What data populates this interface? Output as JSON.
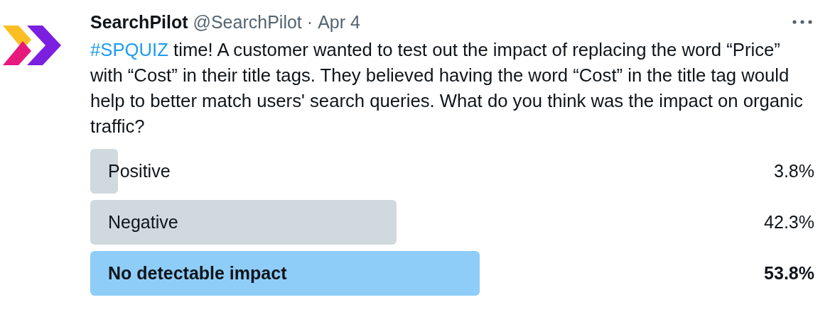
{
  "author": {
    "name": "SearchPilot",
    "handle": "@SearchPilot",
    "separator": "·",
    "date": "Apr 4"
  },
  "tweet": {
    "hashtag": "#SPQUIZ",
    "text": " time! A customer wanted to test out the impact of replacing the word “Price” with “Cost” in their title tags. They believed having the word “Cost” in the title tag would help to better match users' search queries. What do you think was the impact on organic traffic?"
  },
  "poll": [
    {
      "label": "Positive",
      "percent": "3.8%",
      "selected": false
    },
    {
      "label": "Negative",
      "percent": "42.3%",
      "selected": false
    },
    {
      "label": "No detectable impact",
      "percent": "53.8%",
      "selected": true
    }
  ]
}
